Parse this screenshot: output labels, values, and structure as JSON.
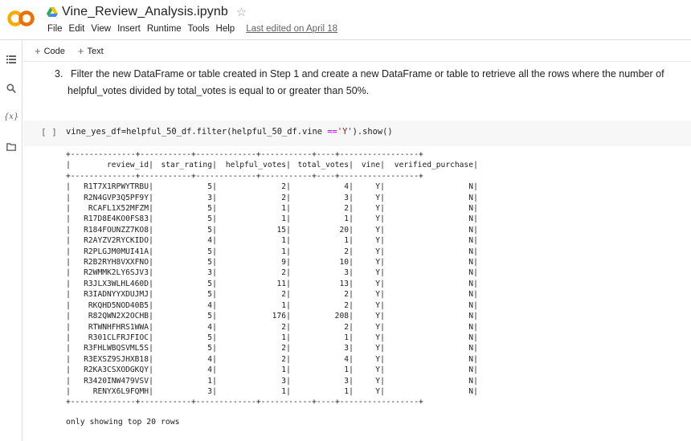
{
  "header": {
    "notebook_title": "Vine_Review_Analysis.ipynb",
    "menu": [
      "File",
      "Edit",
      "View",
      "Insert",
      "Runtime",
      "Tools",
      "Help"
    ],
    "last_edited": "Last edited on April 18"
  },
  "toolbar": {
    "code_label": "Code",
    "text_label": "Text"
  },
  "text_cell": {
    "number": "3.",
    "line1": "Filter the new DataFrame or table created in Step 1 and create a new DataFrame or table to retrieve all the rows where the number of",
    "line2": "helpful_votes divided by total_votes is equal to or greater than 50%."
  },
  "code_cell": {
    "run_bracket": "[ ]",
    "code_pre": "vine_yes_df=helpful_50_df.filter(helpful_50_df.vine ",
    "code_op": "==",
    "code_str": "'Y'",
    "code_post": ").show()"
  },
  "output": {
    "separator": "+--------------+-----------+-------------+-----------+----+-----------------+",
    "headers": [
      "review_id",
      "star_rating",
      "helpful_votes",
      "total_votes",
      "vine",
      "verified_purchase"
    ],
    "rows": [
      [
        "R1T7X1RPWYTRBU",
        "5",
        "2",
        "4",
        "Y",
        "N"
      ],
      [
        "R2N4GVP3Q5PF9Y",
        "3",
        "2",
        "3",
        "Y",
        "N"
      ],
      [
        "RCAFL1X52MFZM",
        "5",
        "1",
        "2",
        "Y",
        "N"
      ],
      [
        "R17D8E4KO0FS83",
        "5",
        "1",
        "1",
        "Y",
        "N"
      ],
      [
        "R184FOUNZZ7KO8",
        "5",
        "15",
        "20",
        "Y",
        "N"
      ],
      [
        "R2AYZV2RYCKIDO",
        "4",
        "1",
        "1",
        "Y",
        "N"
      ],
      [
        "R2PLGJM0MUI41A",
        "5",
        "1",
        "2",
        "Y",
        "N"
      ],
      [
        "R2B2RYH8VXXFNO",
        "5",
        "9",
        "10",
        "Y",
        "N"
      ],
      [
        "R2WMMK2LY6SJV3",
        "3",
        "2",
        "3",
        "Y",
        "N"
      ],
      [
        "R3JLX3WLHL460D",
        "5",
        "11",
        "13",
        "Y",
        "N"
      ],
      [
        "R3IADNYYXDUJMJ",
        "5",
        "2",
        "2",
        "Y",
        "N"
      ],
      [
        "RKQHD5NOD40B5",
        "4",
        "1",
        "2",
        "Y",
        "N"
      ],
      [
        "R82QWN2X2OCHB",
        "5",
        "176",
        "208",
        "Y",
        "N"
      ],
      [
        "RTWNHFHRS1WWA",
        "4",
        "2",
        "2",
        "Y",
        "N"
      ],
      [
        "R301CLFRJFIOC",
        "5",
        "1",
        "1",
        "Y",
        "N"
      ],
      [
        "R3FHLWBQSVML5S",
        "5",
        "2",
        "3",
        "Y",
        "N"
      ],
      [
        "R3EXSZ9SJHXB18",
        "4",
        "2",
        "4",
        "Y",
        "N"
      ],
      [
        "R2KA3CSXODGKQY",
        "4",
        "1",
        "1",
        "Y",
        "N"
      ],
      [
        "R3420INW479VSV",
        "1",
        "3",
        "3",
        "Y",
        "N"
      ],
      [
        "RENYX6L9FQMH",
        "3",
        "1",
        "1",
        "Y",
        "N"
      ]
    ],
    "footer": "only showing top 20 rows"
  }
}
